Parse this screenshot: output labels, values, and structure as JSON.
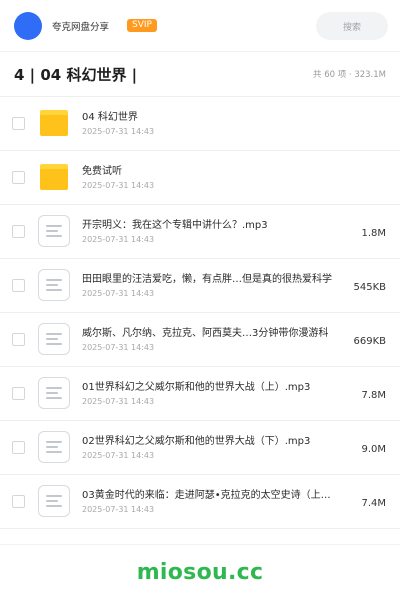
{
  "header": {
    "brand": "夸克网盘分享",
    "badge": "SVIP",
    "search_placeholder": "搜索",
    "colors": {
      "avatar": "#2f6df6",
      "badge": "#ff9a1f"
    }
  },
  "folder": {
    "title": "4 | 04 科幻世界 |",
    "meta": "共 60 项 · 323.1M"
  },
  "files": [
    {
      "type": "folder",
      "icon": "folder-icon",
      "name": "04 科幻世界",
      "date": "2025-07-31 14:43",
      "size": ""
    },
    {
      "type": "folder",
      "icon": "folder-icon",
      "name": "免费试听",
      "date": "2025-07-31 14:43",
      "size": ""
    },
    {
      "type": "file",
      "icon": "document-icon",
      "name": "开宗明义：我在这个专辑中讲什么？.mp3",
      "date": "2025-07-31 14:43",
      "size": "1.8M"
    },
    {
      "type": "file",
      "icon": "document-icon",
      "name": "田田眼里的汪洁爱吃，懒，有点胖…但是真的很热爱科学",
      "date": "2025-07-31 14:43",
      "size": "545KB"
    },
    {
      "type": "file",
      "icon": "document-icon",
      "name": "威尔斯、凡尔纳、克拉克、阿西莫夫…3分钟带你漫游科",
      "date": "2025-07-31 14:43",
      "size": "669KB"
    },
    {
      "type": "file",
      "icon": "document-icon",
      "name": "01世界科幻之父威尔斯和他的世界大战（上）.mp3",
      "date": "2025-07-31 14:43",
      "size": "7.8M"
    },
    {
      "type": "file",
      "icon": "document-icon",
      "name": "02世界科幻之父威尔斯和他的世界大战（下）.mp3",
      "date": "2025-07-31 14:43",
      "size": "9.0M"
    },
    {
      "type": "file",
      "icon": "document-icon",
      "name": "03黄金时代的来临：走进阿瑟•克拉克的太空史诗（上…",
      "date": "2025-07-31 14:43",
      "size": "7.4M"
    }
  ],
  "footer": {
    "watermark": "miosou.cc",
    "color": "#2fb84f"
  }
}
